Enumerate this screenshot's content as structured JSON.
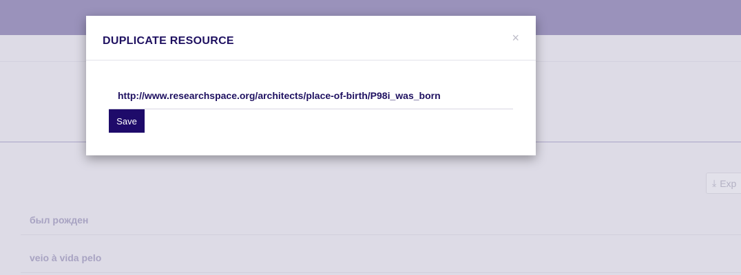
{
  "modal": {
    "title": "DUPLICATE RESOURCE",
    "close": "×",
    "url": "http://www.researchspace.org/architects/place-of-birth/P98i_was_born",
    "save": "Save"
  },
  "background": {
    "export_label": "Exp",
    "export_icon": "download-icon",
    "rows": [
      "был рожден",
      "veio à vida pelo"
    ]
  },
  "colors": {
    "header": "#9a92bb",
    "primary": "#1e0b6a"
  }
}
